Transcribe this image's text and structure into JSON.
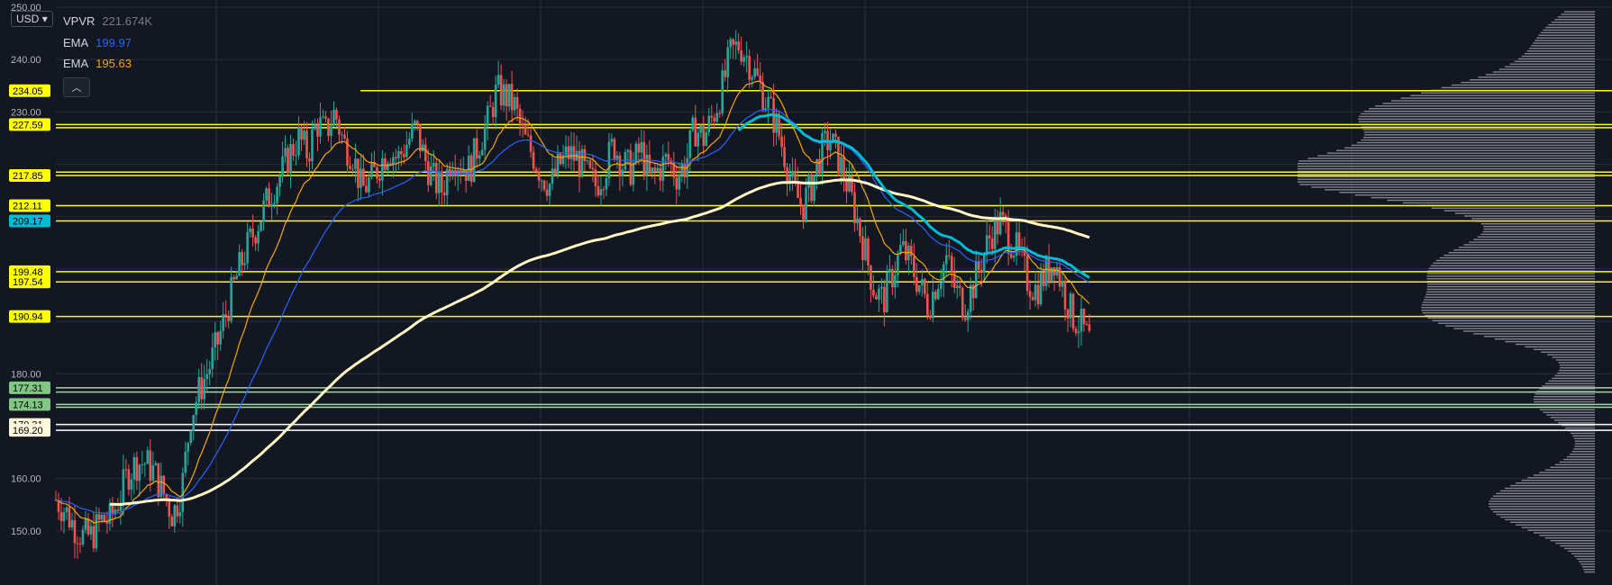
{
  "currency_selector": {
    "label": "USD",
    "icon": "chevron-down-icon"
  },
  "legend": [
    {
      "name": "VPVR",
      "value": "221.674K",
      "color": "#787b86"
    },
    {
      "name": "EMA",
      "value": "199.97",
      "color": "#2962ff"
    },
    {
      "name": "EMA",
      "value": "195.63",
      "color": "#f7a600"
    }
  ],
  "collapse_button": {
    "icon": "chevron-up-icon"
  },
  "colors": {
    "background": "#131722",
    "grid": "#2a2e39",
    "up_candle": "#26a69a",
    "down_candle": "#ef5350",
    "level_yellow": "#ffff00",
    "level_green": "#a5d6a7",
    "level_white": "#ffffff",
    "ema_short": "#f7a600",
    "ema_mid": "#2962ff",
    "ema_cyan": "#00bcd4",
    "ema_long": "#fff8c4",
    "volume_profile": "#9598a1"
  },
  "chart_data": {
    "type": "candlestick",
    "ylim": [
      140,
      250
    ],
    "grid": true,
    "y_tick_labels": [
      "150.00",
      "160.00",
      "180.00",
      "230.00",
      "240.00",
      "250.00"
    ],
    "y_ticks": [
      150,
      160,
      180,
      230,
      240,
      250
    ],
    "price_levels": [
      {
        "label": "234.05",
        "value": 234.05,
        "color": "yellow"
      },
      {
        "label": "227.59",
        "value": 227.59,
        "color": "yellow"
      },
      {
        "value": 227.0,
        "color": "yellow"
      },
      {
        "label": "217.85",
        "value": 217.85,
        "color": "yellow"
      },
      {
        "value": 218.5,
        "color": "yellow"
      },
      {
        "label": "212.11",
        "value": 212.11,
        "color": "yellow"
      },
      {
        "label": "209.17",
        "value": 209.17,
        "color": "cyan"
      },
      {
        "label": "199.48",
        "value": 199.48,
        "color": "yellow"
      },
      {
        "label": "197.54",
        "value": 197.54,
        "color": "yellow"
      },
      {
        "label": "190.94",
        "value": 190.94,
        "color": "yellow"
      },
      {
        "label": "177.31",
        "value": 177.31,
        "color": "green"
      },
      {
        "value": 176.5,
        "color": "green"
      },
      {
        "label": "174.13",
        "value": 174.13,
        "color": "green"
      },
      {
        "value": 173.6,
        "color": "green"
      },
      {
        "label": "170.31",
        "value": 170.31,
        "color": "white"
      },
      {
        "label": "169.20",
        "value": 169.2,
        "color": "white"
      }
    ],
    "price_path": [
      [
        0,
        156
      ],
      [
        10,
        154
      ],
      [
        20,
        151
      ],
      [
        30,
        149
      ],
      [
        40,
        149
      ],
      [
        50,
        152
      ],
      [
        60,
        152
      ],
      [
        70,
        156
      ],
      [
        80,
        161
      ],
      [
        90,
        163
      ],
      [
        100,
        163
      ],
      [
        110,
        161
      ],
      [
        120,
        157
      ],
      [
        130,
        153
      ],
      [
        140,
        158
      ],
      [
        150,
        172
      ],
      [
        160,
        177
      ],
      [
        170,
        181
      ],
      [
        180,
        186
      ],
      [
        190,
        192
      ],
      [
        200,
        198
      ],
      [
        210,
        203
      ],
      [
        220,
        207
      ],
      [
        230,
        211
      ],
      [
        240,
        215
      ],
      [
        250,
        218
      ],
      [
        260,
        222
      ],
      [
        270,
        225
      ],
      [
        280,
        222
      ],
      [
        290,
        228
      ],
      [
        300,
        226
      ],
      [
        310,
        230
      ],
      [
        320,
        224
      ],
      [
        330,
        222
      ],
      [
        340,
        215
      ],
      [
        350,
        217
      ],
      [
        360,
        220
      ],
      [
        370,
        223
      ],
      [
        380,
        221
      ],
      [
        390,
        224
      ],
      [
        400,
        227
      ],
      [
        410,
        221
      ],
      [
        420,
        217
      ],
      [
        430,
        215
      ],
      [
        440,
        222
      ],
      [
        450,
        220
      ],
      [
        460,
        219
      ],
      [
        470,
        224
      ],
      [
        480,
        228
      ],
      [
        490,
        234
      ],
      [
        500,
        233
      ],
      [
        510,
        231
      ],
      [
        520,
        225
      ],
      [
        530,
        222
      ],
      [
        540,
        218
      ],
      [
        550,
        216
      ],
      [
        560,
        220
      ],
      [
        570,
        222
      ],
      [
        580,
        221
      ],
      [
        590,
        218
      ],
      [
        600,
        216
      ],
      [
        610,
        219
      ],
      [
        620,
        224
      ],
      [
        630,
        220
      ],
      [
        640,
        219
      ],
      [
        650,
        223
      ],
      [
        660,
        217
      ],
      [
        670,
        219
      ],
      [
        680,
        221
      ],
      [
        690,
        218
      ],
      [
        700,
        220
      ],
      [
        710,
        227
      ],
      [
        720,
        225
      ],
      [
        730,
        229
      ],
      [
        740,
        234
      ],
      [
        750,
        241
      ],
      [
        760,
        243
      ],
      [
        770,
        240
      ],
      [
        780,
        236
      ],
      [
        790,
        232
      ],
      [
        800,
        228
      ],
      [
        810,
        222
      ],
      [
        820,
        215
      ],
      [
        830,
        212
      ],
      [
        840,
        216
      ],
      [
        850,
        222
      ],
      [
        860,
        225
      ],
      [
        870,
        221
      ],
      [
        880,
        216
      ],
      [
        890,
        210
      ],
      [
        900,
        203
      ],
      [
        910,
        196
      ],
      [
        920,
        194
      ],
      [
        930,
        199
      ],
      [
        940,
        204
      ],
      [
        950,
        201
      ],
      [
        960,
        197
      ],
      [
        970,
        193
      ],
      [
        980,
        198
      ],
      [
        990,
        202
      ],
      [
        1000,
        196
      ],
      [
        1010,
        193
      ],
      [
        1020,
        197
      ],
      [
        1030,
        202
      ],
      [
        1040,
        207
      ],
      [
        1050,
        209
      ],
      [
        1060,
        206
      ],
      [
        1070,
        203
      ],
      [
        1080,
        198
      ],
      [
        1090,
        196
      ],
      [
        1100,
        199
      ],
      [
        1110,
        202
      ],
      [
        1120,
        196
      ],
      [
        1130,
        191
      ],
      [
        1140,
        189
      ],
      [
        1150,
        186
      ]
    ],
    "ema_short_last": 195.63,
    "ema_mid_last": 199.97
  }
}
